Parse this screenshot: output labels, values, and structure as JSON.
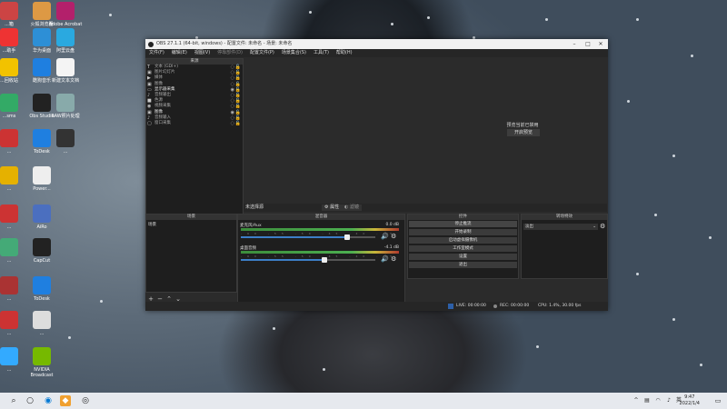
{
  "desktop": {
    "icons": [
      {
        "label": "...箱",
        "icon": "box-icon",
        "color": "#c44"
      },
      {
        "label": "火狐浏览器",
        "icon": "app-icon",
        "color": "#d94"
      },
      {
        "label": "Adobe Acrobat",
        "icon": "acrobat-icon",
        "color": "#b3206b"
      },
      {
        "label": "...助手",
        "icon": "app-icon",
        "color": "#e33"
      },
      {
        "label": "华为桌面",
        "icon": "app-icon",
        "color": "#2d8fd6"
      },
      {
        "label": "阿里云盘",
        "icon": "cloud-icon",
        "color": "#2aa9e0"
      },
      {
        "label": "...回收站",
        "icon": "app-icon",
        "color": "#f2c200"
      },
      {
        "label": "酷狗音乐",
        "icon": "kugou-icon",
        "color": "#1f7fe0"
      },
      {
        "label": "新建文本文档",
        "icon": "document-icon",
        "color": "#f4f4f4"
      },
      {
        "label": "...sms",
        "icon": "app-icon",
        "color": "#3a6"
      },
      {
        "label": "Obs Studio",
        "icon": "obs-icon",
        "color": "#222"
      },
      {
        "label": "RAW照片处理",
        "icon": "image-icon",
        "color": "#8aa"
      },
      {
        "label": "...",
        "icon": "app-icon",
        "color": "#c33"
      },
      {
        "label": "ToDesk",
        "icon": "todesk-icon",
        "color": "#1f7fe0"
      },
      {
        "label": "...",
        "icon": "photo-icon",
        "color": "#333"
      },
      {
        "label": "...",
        "icon": "chrome-icon",
        "color": "#e5b100"
      },
      {
        "label": "Power...",
        "icon": "folder-icon",
        "color": "#eee"
      },
      {
        "label": "...",
        "icon": "app-icon",
        "color": "#c33"
      },
      {
        "label": "AiRo",
        "icon": "app-icon",
        "color": "#4b6fbf"
      },
      {
        "label": "...",
        "icon": "app-icon",
        "color": "#4a7"
      },
      {
        "label": "CapCut",
        "icon": "capcut-icon",
        "color": "#222"
      },
      {
        "label": "...",
        "icon": "app-icon",
        "color": "#a33"
      },
      {
        "label": "ToDesk",
        "icon": "todesk-icon",
        "color": "#1f7fe0"
      },
      {
        "label": "...",
        "icon": "app-icon",
        "color": "#c33"
      },
      {
        "label": "...",
        "icon": "app-icon",
        "color": "#ddd"
      },
      {
        "label": "...",
        "icon": "app-icon",
        "color": "#3af"
      },
      {
        "label": "NVIDIA Broadcast",
        "icon": "nvidia-icon",
        "color": "#76b900"
      }
    ]
  },
  "obs": {
    "title": "OBS 27.1.1 (64-bit, windows) - 配置文件: 未命名 - 场景: 未命名",
    "menu": [
      "文件(F)",
      "编辑(E)",
      "视图(V)",
      "停靠部件(D)",
      "配置文件(P)",
      "场景集合(S)",
      "工具(T)",
      "帮助(H)"
    ],
    "sources_header": "来源",
    "sources": [
      {
        "icon": "text-icon",
        "glyph": "T",
        "label": "文本 (GDI+)",
        "visible": false
      },
      {
        "icon": "image-icon",
        "glyph": "▣",
        "label": "图片幻灯片",
        "visible": false
      },
      {
        "icon": "media-icon",
        "glyph": "▶",
        "label": "媒体",
        "visible": false
      },
      {
        "icon": "image-icon",
        "glyph": "▣",
        "label": "图像",
        "visible": false
      },
      {
        "icon": "monitor-icon",
        "glyph": "▭",
        "label": "显示器采集",
        "visible": true
      },
      {
        "icon": "audio-icon",
        "glyph": "♪",
        "label": "音频输出",
        "visible": false
      },
      {
        "icon": "color-icon",
        "glyph": "■",
        "label": "色源",
        "visible": false
      },
      {
        "icon": "camera-icon",
        "glyph": "◉",
        "label": "视频采集",
        "visible": false
      },
      {
        "icon": "image-icon",
        "glyph": "▣",
        "label": "图像",
        "visible": true
      },
      {
        "icon": "audio-icon",
        "glyph": "♪",
        "label": "音频输入",
        "visible": false
      },
      {
        "icon": "window-icon",
        "glyph": "▢",
        "label": "窗口采集",
        "visible": false
      }
    ],
    "preview": {
      "message": "预览当前已禁用",
      "button": "开启预览"
    },
    "toolbar": {
      "no_source_label": "未选择源",
      "properties_label": "属性",
      "filters_label": "滤镜"
    },
    "scenes": {
      "header": "场景",
      "items": [
        "场景"
      ]
    },
    "mixer": {
      "header": "混音器",
      "tracks": [
        {
          "name": "麦克风/Aux",
          "db": "0.0 dB",
          "volume": 0.79
        },
        {
          "name": "桌面音频",
          "db": "-4.1 dB",
          "volume": 0.62
        }
      ],
      "ticks": "-60 -55 -50 -45 -40 -35 -30 -25 -20 -15 -10 -5 0"
    },
    "controls": {
      "header": "控件",
      "buttons": [
        "停止推流",
        "开始录制",
        "启动虚拟摄像机",
        "工作室模式",
        "设置",
        "退出"
      ]
    },
    "transitions": {
      "header": "转场特效",
      "selected": "淡出"
    },
    "status": {
      "live": "LIVE: 00:00:00",
      "rec": "REC: 00:00:00",
      "cpu": "CPU: 1.4%, 30.00 fps"
    }
  },
  "taskbar": {
    "time": "9:47",
    "date": "2022/1/4"
  }
}
